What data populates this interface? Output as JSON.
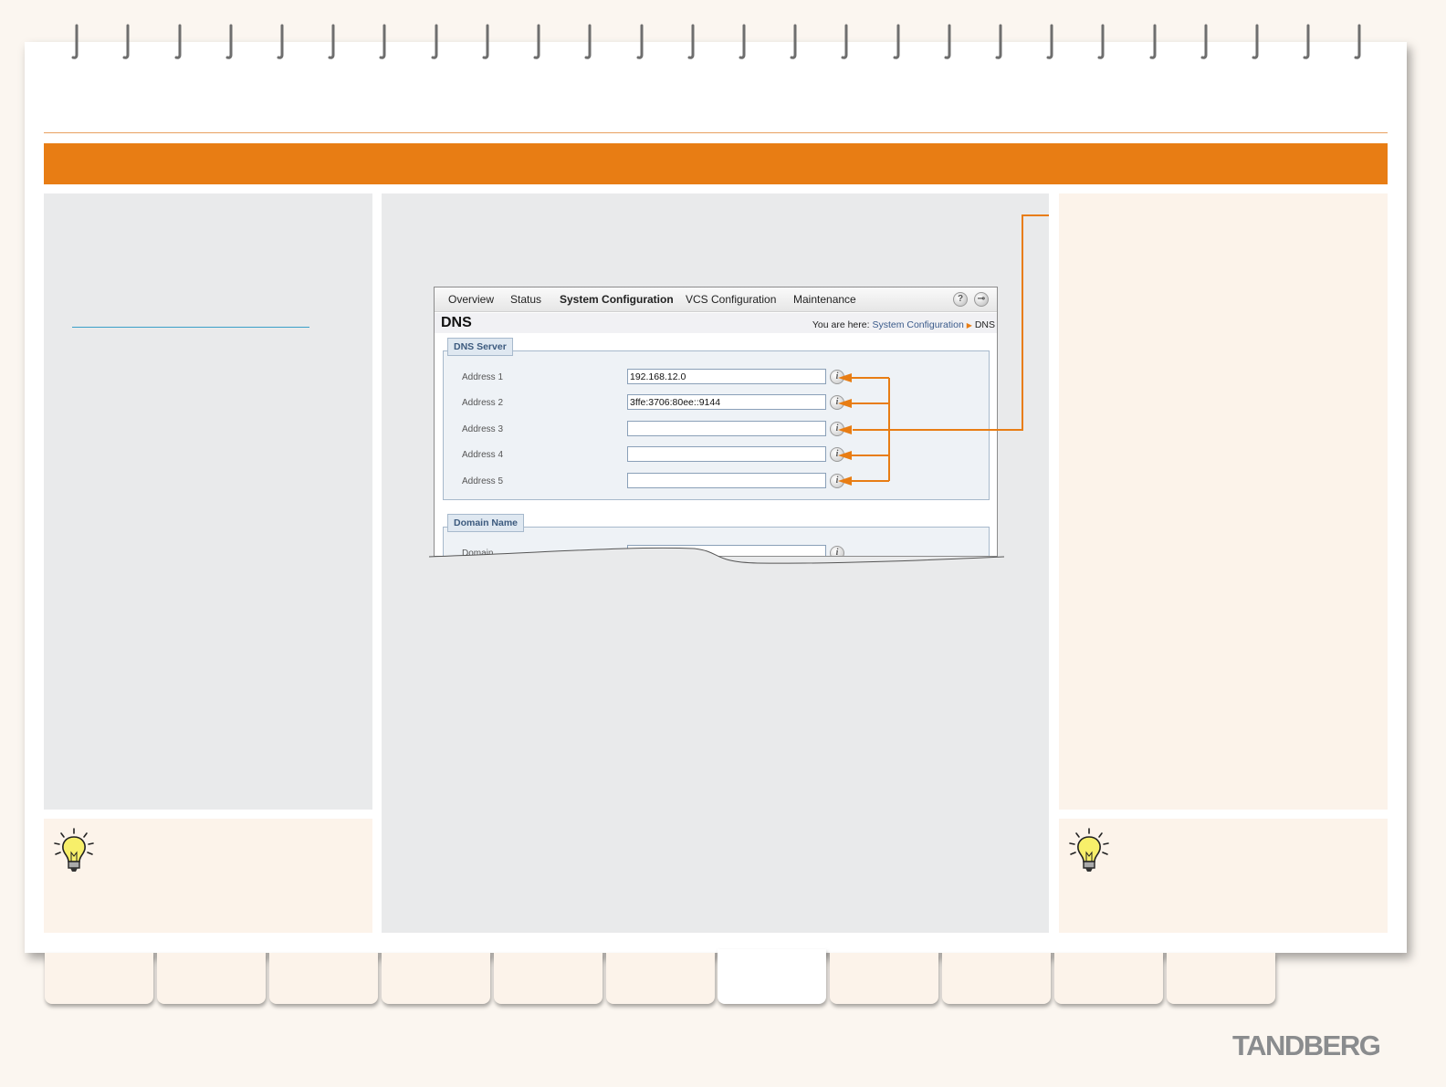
{
  "window": {
    "nav": {
      "items": [
        "Overview",
        "Status",
        "System Configuration",
        "VCS Configuration",
        "Maintenance"
      ],
      "active": "System Configuration",
      "help_icon": "help-icon",
      "logout_icon": "logout-key-icon"
    },
    "page_title": "DNS",
    "breadcrumb": {
      "prefix": "You are here:",
      "parent": "System Configuration",
      "current": "DNS"
    },
    "dns_server": {
      "legend": "DNS Server",
      "rows": [
        {
          "label": "Address 1",
          "value": "192.168.12.0"
        },
        {
          "label": "Address 2",
          "value": "3ffe:3706:80ee::9144"
        },
        {
          "label": "Address 3",
          "value": ""
        },
        {
          "label": "Address 4",
          "value": ""
        },
        {
          "label": "Address 5",
          "value": ""
        }
      ]
    },
    "domain_name": {
      "legend": "Domain Name",
      "row_label": "Domain"
    }
  },
  "brand": "TANDBERG",
  "colors": {
    "accent": "#e87d14",
    "panel_grey": "#e9eaeb",
    "panel_cream": "#fcf3ea"
  }
}
